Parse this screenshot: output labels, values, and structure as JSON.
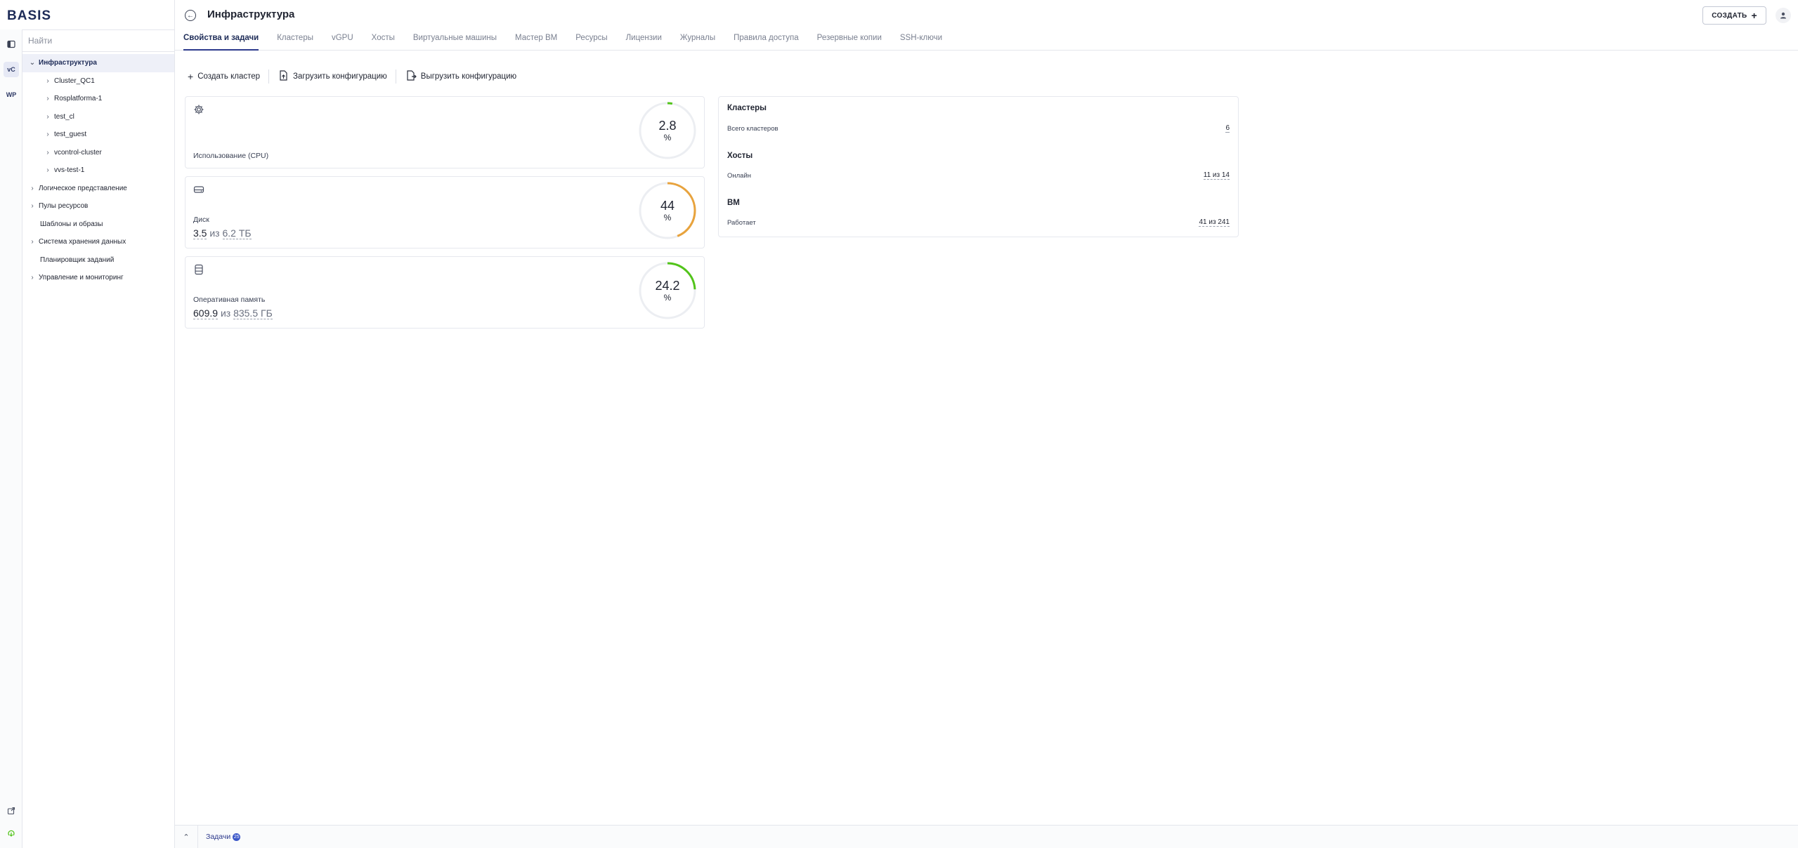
{
  "logo": "BASIS",
  "rail": {
    "items": [
      {
        "label": "vC"
      },
      {
        "label": "WP"
      }
    ]
  },
  "sidebar": {
    "search_placeholder": "Найти",
    "tree": [
      {
        "label": "Инфраструктура",
        "expanded": true,
        "selected": true
      },
      {
        "label": "Cluster_QC1"
      },
      {
        "label": "Rosplatforma-1"
      },
      {
        "label": "test_cl"
      },
      {
        "label": "test_guest"
      },
      {
        "label": "vcontrol-cluster"
      },
      {
        "label": "vvs-test-1"
      },
      {
        "label": "Логическое представление"
      },
      {
        "label": "Пулы ресурсов"
      },
      {
        "label": "Шаблоны и образы"
      },
      {
        "label": "Система хранения данных"
      },
      {
        "label": "Планировщик заданий"
      },
      {
        "label": "Управление и мониторинг"
      }
    ]
  },
  "header": {
    "title": "Инфраструктура",
    "create_label": "СОЗДАТЬ"
  },
  "tabs": [
    {
      "label": "Свойства и задачи",
      "active": true
    },
    {
      "label": "Кластеры"
    },
    {
      "label": "vGPU"
    },
    {
      "label": "Хосты"
    },
    {
      "label": "Виртуальные машины"
    },
    {
      "label": "Мастер ВМ"
    },
    {
      "label": "Ресурсы"
    },
    {
      "label": "Лицензии"
    },
    {
      "label": "Журналы"
    },
    {
      "label": "Правила доступа"
    },
    {
      "label": "Резервные копии"
    },
    {
      "label": "SSH-ключи"
    }
  ],
  "toolbar": {
    "create_cluster": "Создать кластер",
    "upload_config": "Загрузить конфигурацию",
    "download_config": "Выгрузить конфигурацию"
  },
  "cards": {
    "cpu": {
      "label": "Использование (CPU)",
      "percent": "2.8",
      "unit": "%",
      "fraction": 0.028,
      "color": "#52c41a",
      "icon": "gear-icon"
    },
    "disk": {
      "label": "Диск",
      "used": "3.5",
      "of": "из",
      "total": "6.2 ТБ",
      "percent": "44",
      "unit": "%",
      "fraction": 0.44,
      "color": "#e8a33d",
      "icon": "disk-icon"
    },
    "ram": {
      "label": "Оперативная память",
      "used": "609.9",
      "of": "из",
      "total": "835.5 ГБ",
      "percent": "24.2",
      "unit": "%",
      "fraction": 0.242,
      "color": "#52c41a",
      "icon": "database-icon"
    }
  },
  "summary": {
    "clusters_title": "Кластеры",
    "clusters_label": "Всего кластеров",
    "clusters_value": "6",
    "hosts_title": "Хосты",
    "hosts_label": "Онлайн",
    "hosts_value": "11 из 14",
    "vm_title": "ВМ",
    "vm_label": "Работает",
    "vm_value": "41 из 241"
  },
  "bottombar": {
    "tasks_label": "Задачи",
    "tasks_count": "25"
  }
}
